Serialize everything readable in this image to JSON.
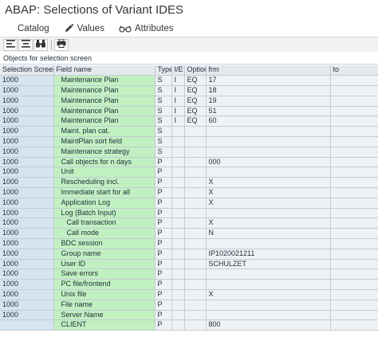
{
  "window": {
    "title": "ABAP: Selections of Variant IDES"
  },
  "menu": {
    "catalog_label": "Catalog",
    "values_label": "Values",
    "attributes_label": "Attributes"
  },
  "section": {
    "title": "Objects for selection screen"
  },
  "table": {
    "headers": {
      "selection_screen": "Selection Screen",
      "field_name": "Field name",
      "type": "Type",
      "ie": "I/E",
      "option": "Option",
      "from": "frm",
      "to": "to"
    },
    "rows": [
      {
        "screen": "1000",
        "field": "Maintenance Plan",
        "type": "S",
        "ie": "I",
        "option": "EQ",
        "from": "17",
        "to": ""
      },
      {
        "screen": "1000",
        "field": "Maintenance Plan",
        "type": "S",
        "ie": "I",
        "option": "EQ",
        "from": "18",
        "to": ""
      },
      {
        "screen": "1000",
        "field": "Maintenance Plan",
        "type": "S",
        "ie": "I",
        "option": "EQ",
        "from": "19",
        "to": ""
      },
      {
        "screen": "1000",
        "field": "Maintenance Plan",
        "type": "S",
        "ie": "I",
        "option": "EQ",
        "from": "51",
        "to": ""
      },
      {
        "screen": "1000",
        "field": "Maintenance Plan",
        "type": "S",
        "ie": "I",
        "option": "EQ",
        "from": "60",
        "to": ""
      },
      {
        "screen": "1000",
        "field": "Maint. plan cat.",
        "type": "S",
        "ie": "",
        "option": "",
        "from": "",
        "to": ""
      },
      {
        "screen": "1000",
        "field": "MaintPlan sort field",
        "type": "S",
        "ie": "",
        "option": "",
        "from": "",
        "to": ""
      },
      {
        "screen": "1000",
        "field": "Maintenance strategy",
        "type": "S",
        "ie": "",
        "option": "",
        "from": "",
        "to": ""
      },
      {
        "screen": "1000",
        "field": "Call objects for n days",
        "type": "P",
        "ie": "",
        "option": "",
        "from": "000",
        "to": ""
      },
      {
        "screen": "1000",
        "field": "Unit",
        "type": "P",
        "ie": "",
        "option": "",
        "from": "",
        "to": ""
      },
      {
        "screen": "1000",
        "field": "Rescheduling incl.",
        "type": "P",
        "ie": "",
        "option": "",
        "from": "X",
        "to": ""
      },
      {
        "screen": "1000",
        "field": "Immediate start for all",
        "type": "P",
        "ie": "",
        "option": "",
        "from": "X",
        "to": ""
      },
      {
        "screen": "1000",
        "field": "Application Log",
        "type": "P",
        "ie": "",
        "option": "",
        "from": "X",
        "to": ""
      },
      {
        "screen": "1000",
        "field": "Log (Batch Input)",
        "type": "P",
        "ie": "",
        "option": "",
        "from": "",
        "to": ""
      },
      {
        "screen": "1000",
        "field": "Call transaction",
        "type": "P",
        "ie": "",
        "option": "",
        "from": "X",
        "to": ""
      },
      {
        "screen": "1000",
        "field": "Call mode",
        "type": "P",
        "ie": "",
        "option": "",
        "from": "N",
        "to": ""
      },
      {
        "screen": "1000",
        "field": "BDC session",
        "type": "P",
        "ie": "",
        "option": "",
        "from": "",
        "to": ""
      },
      {
        "screen": "1000",
        "field": "Group name",
        "type": "P",
        "ie": "",
        "option": "",
        "from": "IP1020021211",
        "to": ""
      },
      {
        "screen": "1000",
        "field": "User ID",
        "type": "P",
        "ie": "",
        "option": "",
        "from": "SCHULZET",
        "to": ""
      },
      {
        "screen": "1000",
        "field": "Save errors",
        "type": "P",
        "ie": "",
        "option": "",
        "from": "",
        "to": ""
      },
      {
        "screen": "1000",
        "field": "PC file/frontend",
        "type": "P",
        "ie": "",
        "option": "",
        "from": "",
        "to": ""
      },
      {
        "screen": "1000",
        "field": "Unix file",
        "type": "P",
        "ie": "",
        "option": "",
        "from": "X",
        "to": ""
      },
      {
        "screen": "1000",
        "field": "File name",
        "type": "P",
        "ie": "",
        "option": "",
        "from": "",
        "to": ""
      },
      {
        "screen": "1000",
        "field": "Server Name",
        "type": "P",
        "ie": "",
        "option": "",
        "from": "",
        "to": ""
      },
      {
        "screen": "",
        "field": "CLIENT",
        "type": "P",
        "ie": "",
        "option": "",
        "from": "800",
        "to": ""
      }
    ]
  },
  "colors": {
    "field_name_bg": "#c1f0c1",
    "selection_screen_bg": "#d4e4f1",
    "header_bg": "#e4e9ee",
    "cell_bg": "#eef2f5"
  },
  "icons": {
    "values": "pencil-icon",
    "attributes": "glasses-icon",
    "toolbar": [
      "align-left-icon",
      "align-center-icon",
      "binoculars-icon",
      "print-icon"
    ]
  }
}
